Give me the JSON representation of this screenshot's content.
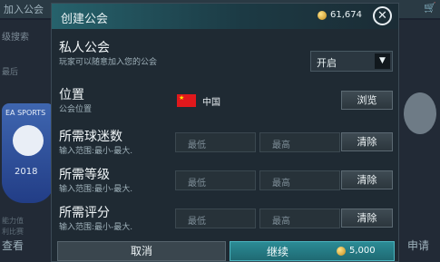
{
  "background": {
    "top_left": "加入公会",
    "left_search": "级搜索",
    "left_small": "最后",
    "badge_brand": "EA SPORTS",
    "badge_year": "2018",
    "left_stats": [
      "能力值",
      "利比赛"
    ],
    "left_bottom": "查看",
    "right_bottom": "申请"
  },
  "modal": {
    "title": "创建公会",
    "coins": "61,674",
    "rows": {
      "private": {
        "label": "私人公会",
        "sub": "玩家可以随意加入您的公会",
        "dropdown_value": "开启"
      },
      "location": {
        "label": "位置",
        "sub": "公会位置",
        "country": "中国",
        "button": "浏览"
      },
      "fans": {
        "label": "所需球迷数",
        "sub": "输入范围:最小-最大.",
        "min_placeholder": "最低",
        "max_placeholder": "最高",
        "button": "清除"
      },
      "level": {
        "label": "所需等级",
        "sub": "输入范围:最小-最大.",
        "min_placeholder": "最低",
        "max_placeholder": "最高",
        "button": "清除"
      },
      "rating": {
        "label": "所需评分",
        "sub": "输入范围:最小-最大.",
        "min_placeholder": "最低",
        "max_placeholder": "最高",
        "button": "清除"
      }
    },
    "footer": {
      "cancel": "取消",
      "continue": "继续",
      "price": "5,000"
    }
  }
}
